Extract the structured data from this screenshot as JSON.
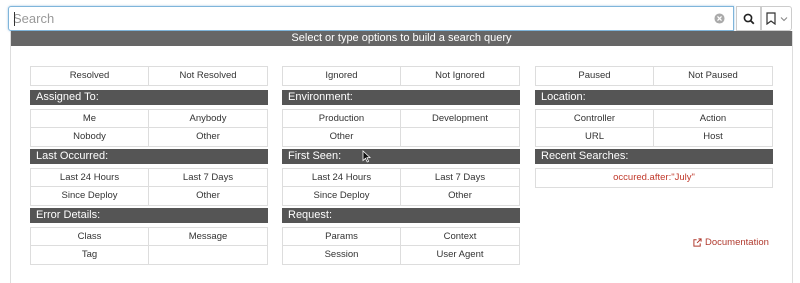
{
  "search": {
    "placeholder": "Search",
    "value": ""
  },
  "icons": {
    "clear": "clear-circle-icon",
    "search": "search-icon",
    "bookmark": "bookmark-icon",
    "chevron": "chevron-down-icon",
    "external": "external-link-icon"
  },
  "panel": {
    "header": "Select or type options to build a search query"
  },
  "columns": [
    {
      "top": {
        "options": [
          "Resolved",
          "Not Resolved"
        ]
      },
      "sections": [
        {
          "title": "Assigned To:",
          "options": [
            "Me",
            "Anybody",
            "Nobody",
            "Other"
          ]
        },
        {
          "title": "Last Occurred:",
          "options": [
            "Last 24 Hours",
            "Last 7 Days",
            "Since Deploy",
            "Other"
          ]
        },
        {
          "title": "Error Details:",
          "options": [
            "Class",
            "Message",
            "Tag",
            ""
          ]
        }
      ]
    },
    {
      "top": {
        "options": [
          "Ignored",
          "Not Ignored"
        ]
      },
      "sections": [
        {
          "title": "Environment:",
          "options": [
            "Production",
            "Development",
            "Other",
            ""
          ]
        },
        {
          "title": "First Seen:",
          "options": [
            "Last 24 Hours",
            "Last 7 Days",
            "Since Deploy",
            "Other"
          ]
        },
        {
          "title": "Request:",
          "options": [
            "Params",
            "Context",
            "Session",
            "User Agent"
          ]
        }
      ]
    },
    {
      "top": {
        "options": [
          "Paused",
          "Not Paused"
        ]
      },
      "sections": [
        {
          "title": "Location:",
          "options": [
            "Controller",
            "Action",
            "URL",
            "Host"
          ]
        }
      ],
      "recent": {
        "title": "Recent Searches:",
        "items": [
          "occured.after:\"July\""
        ]
      }
    }
  ],
  "documentation": {
    "label": "Documentation"
  },
  "colors": {
    "section_bg": "#555555",
    "header_bg": "#666666",
    "link": "#b03a2e",
    "focus": "#7fb5da"
  }
}
